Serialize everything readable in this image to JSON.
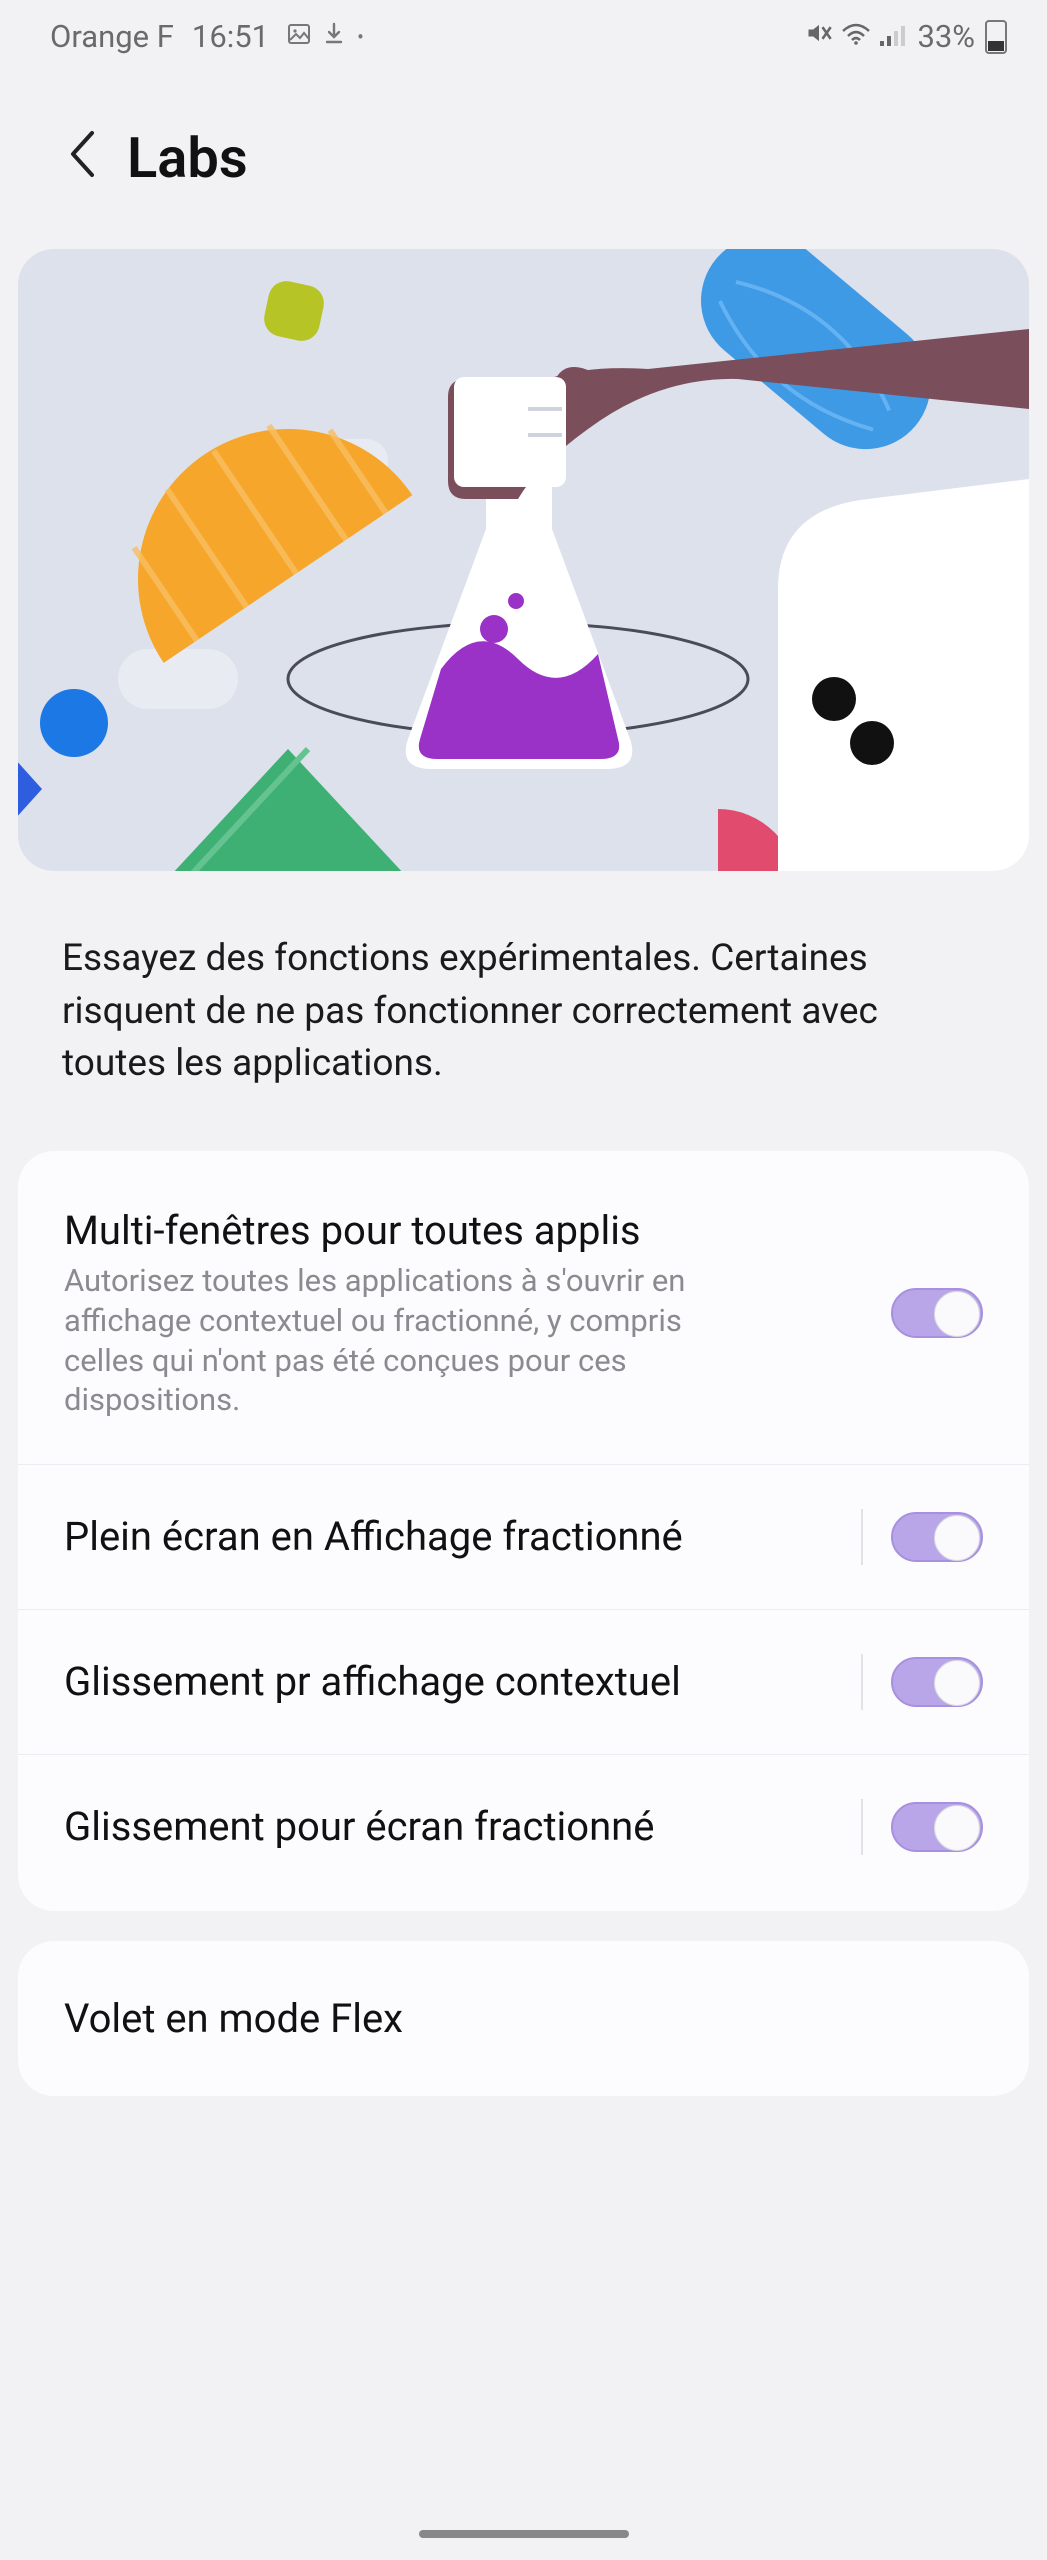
{
  "status": {
    "carrier": "Orange F",
    "time": "16:51",
    "battery": "33%"
  },
  "header": {
    "title": "Labs"
  },
  "intro": "Essayez des fonctions expérimentales. Certaines risquent de ne pas fonctionner correctement avec toutes les applications.",
  "rows": [
    {
      "title": "Multi-fenêtres pour toutes applis",
      "sub": "Autorisez toutes les applications à s'ouvrir en affichage contextuel ou fractionné, y compris celles qui n'ont pas été conçues pour ces dispositions."
    },
    {
      "title": "Plein écran en Affichage fractionné"
    },
    {
      "title": "Glissement pr affichage contextuel"
    },
    {
      "title": "Glissement pour écran fractionné"
    }
  ],
  "flex": {
    "title": "Volet en mode Flex"
  }
}
